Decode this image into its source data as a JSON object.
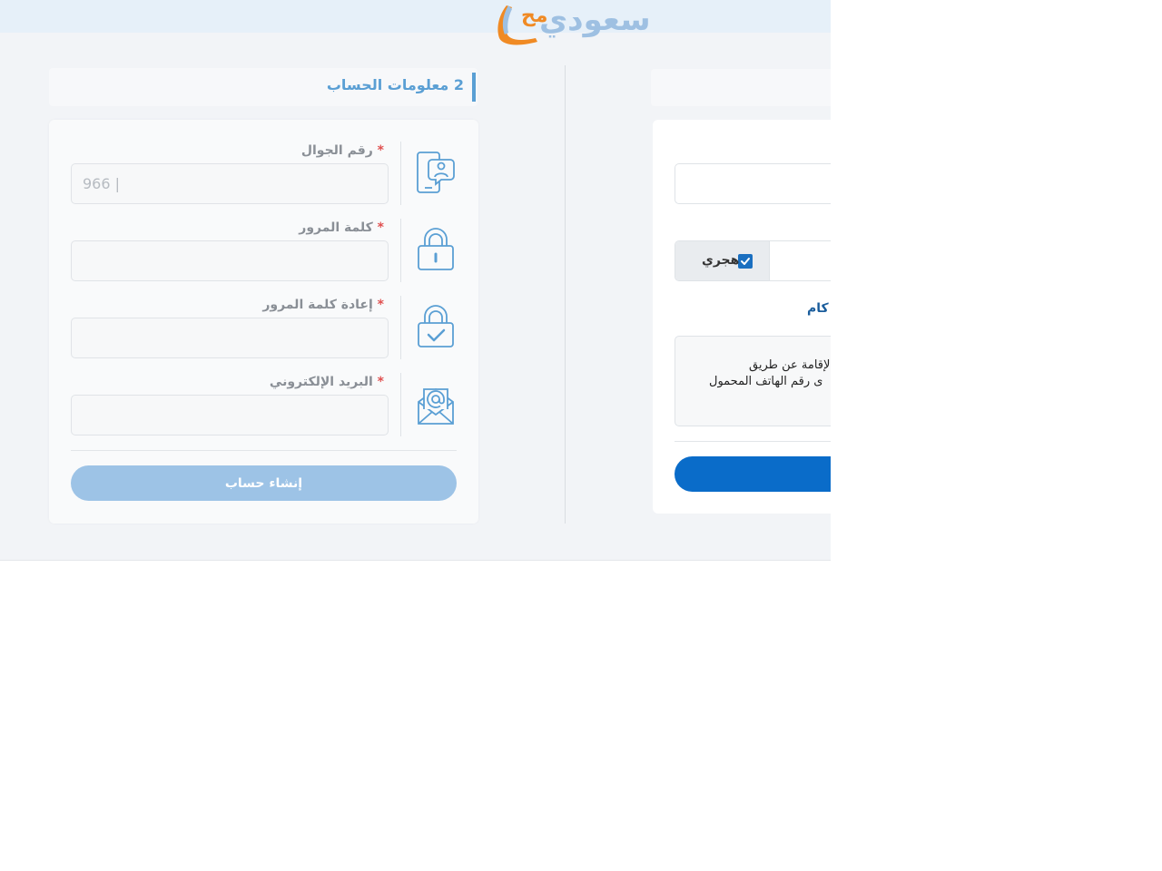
{
  "header": {
    "logo_text": "سعودي",
    "logo_mark": "مح"
  },
  "section": {
    "number": "2",
    "title": "معلومات الحساب"
  },
  "fields": {
    "mobile": {
      "label": "رقم الجوال",
      "required_mark": "*",
      "placeholder": "966 |",
      "icon": "mobile-user-icon"
    },
    "password": {
      "label": "كلمة المرور",
      "required_mark": "*",
      "placeholder": "",
      "icon": "padlock-icon"
    },
    "password_confirm": {
      "label": "إعادة كلمة المرور",
      "required_mark": "*",
      "placeholder": "",
      "icon": "padlock-check-icon"
    },
    "email": {
      "label": "البريد الإلكتروني",
      "required_mark": "*",
      "placeholder": "",
      "icon": "envelope-at-icon"
    }
  },
  "buttons": {
    "create_account": "إنشاء حساب"
  },
  "right_panel": {
    "hijri_label": "هجري",
    "hijri_checked": true,
    "terms_text": "كام",
    "info_line1": "ية / الإقامة عن طريق",
    "info_line2": "ى رقم الهاتف المحمول"
  },
  "colors": {
    "accent": "#5a9fd4",
    "button_disabled": "#9dc3e6",
    "primary_button": "#0a6cc9",
    "required": "#e05050",
    "logo_orange": "#f08a24"
  }
}
